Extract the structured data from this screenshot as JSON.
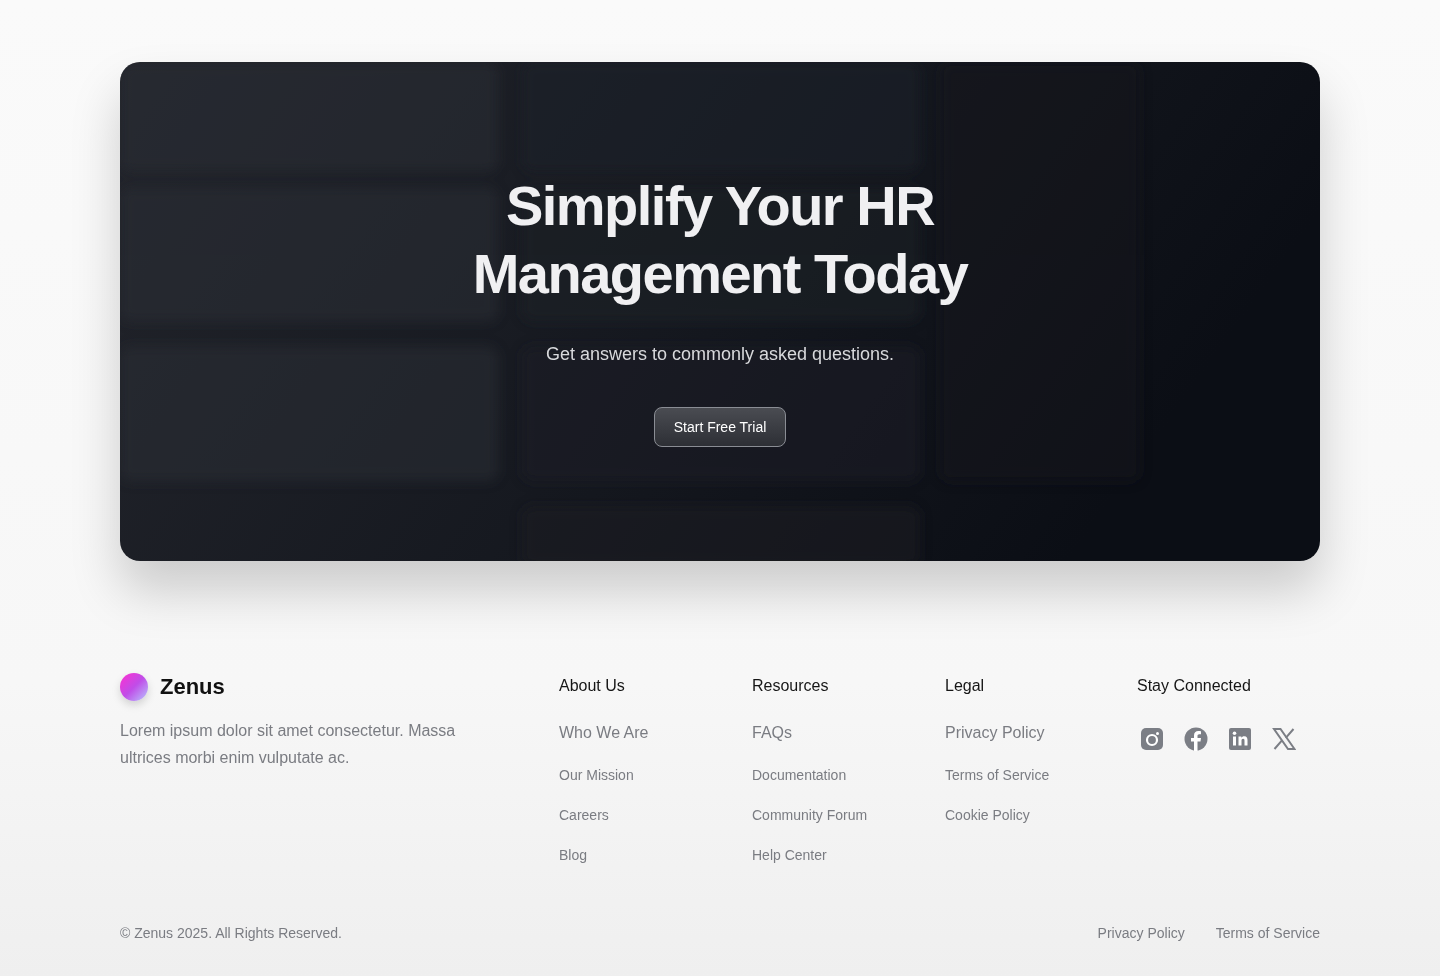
{
  "hero": {
    "title_lines": [
      "Simplify Your HR",
      "Management Today"
    ],
    "subtitle": "Get answers to commonly asked questions.",
    "button": "Start Free Trial"
  },
  "footer": {
    "brand": {
      "name": "Zenus",
      "description": "Lorem ipsum dolor sit amet consectetur. Massa ultrices morbi enim vulputate ac."
    },
    "columns": [
      {
        "heading": "About Us",
        "links": [
          "Who We Are",
          "Our Mission",
          "Careers",
          "Blog"
        ]
      },
      {
        "heading": "Resources",
        "links": [
          "FAQs",
          "Documentation",
          "Community Forum",
          "Help Center"
        ]
      },
      {
        "heading": "Legal",
        "links": [
          "Privacy Policy",
          "Terms of Service",
          "Cookie Policy"
        ]
      }
    ],
    "social": {
      "heading": "Stay Connected"
    },
    "copyright": "© Zenus 2025. All Rights Reserved.",
    "bottom_links": [
      "Privacy Policy",
      "Terms of Service"
    ]
  }
}
